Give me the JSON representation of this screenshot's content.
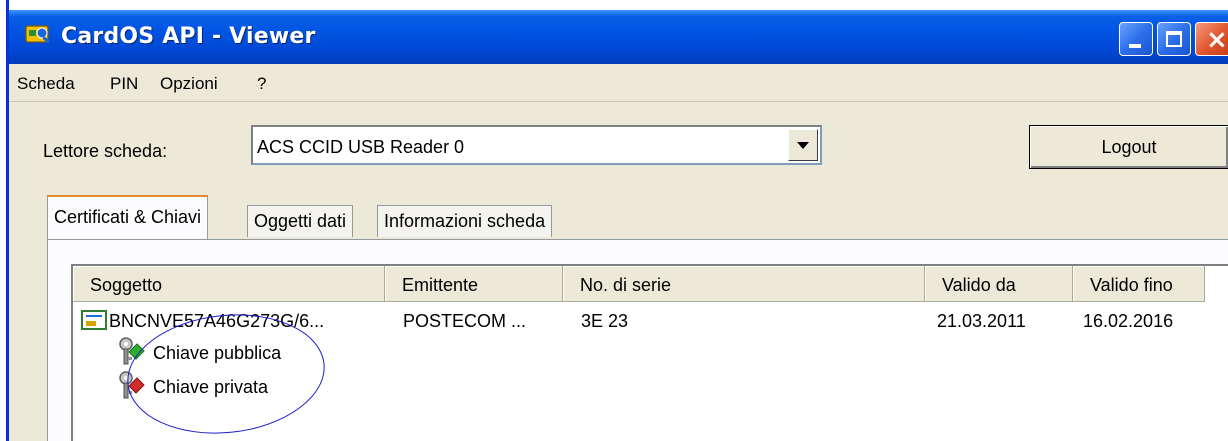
{
  "window": {
    "title": "CardOS API - Viewer"
  },
  "menu": {
    "items": [
      "Scheda",
      "PIN",
      "Opzioni",
      "?"
    ]
  },
  "reader": {
    "label": "Lettore scheda:",
    "selected": "ACS CCID USB Reader 0"
  },
  "logout": {
    "label": "Logout"
  },
  "tabs": [
    {
      "label": "Certificati & Chiavi",
      "active": true
    },
    {
      "label": "Oggetti dati",
      "active": false
    },
    {
      "label": "Informazioni scheda",
      "active": false
    }
  ],
  "table": {
    "columns": [
      "Soggetto",
      "Emittente",
      "No. di serie",
      "Valido da",
      "Valido fino"
    ],
    "rows": [
      {
        "subject": "BNCNVE57A46G273G/6...",
        "issuer": "POSTECOM ...",
        "serial": "3E 23",
        "valid_from": "21.03.2011",
        "valid_to": "16.02.2016",
        "icon": "certificate-icon",
        "children": [
          {
            "label": "Chiave pubblica",
            "icon": "public-key-icon"
          },
          {
            "label": "Chiave privata",
            "icon": "private-key-icon"
          }
        ]
      }
    ]
  },
  "colors": {
    "titlebar": "#0054e3",
    "window_bg": "#ece9d8",
    "annotation": "#1a1acc",
    "public_key": "#2eae2e",
    "private_key": "#d22d2d",
    "active_tab_accent": "#e68b2c"
  }
}
